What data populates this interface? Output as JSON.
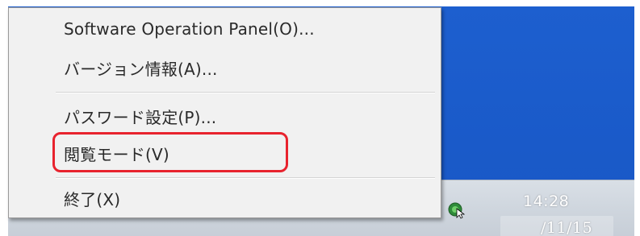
{
  "context_menu": {
    "items": [
      {
        "label": "Software Operation Panel(O)..."
      },
      {
        "label": "バージョン情報(A)..."
      },
      {
        "label": "パスワード設定(P)..."
      },
      {
        "label": "閲覧モード(V)"
      },
      {
        "label": "終了(X)"
      }
    ],
    "highlight_color": "#e8232e"
  },
  "taskbar": {
    "clock": {
      "time": "14:28",
      "date": "/11/15"
    },
    "tray_icons": [
      "yellow-tray-icon",
      "scanner-tray-icon"
    ]
  },
  "colors": {
    "desktop": "#1d5fcf",
    "menu_background": "#f1f1f1",
    "taskbar": "#d2d8df"
  }
}
